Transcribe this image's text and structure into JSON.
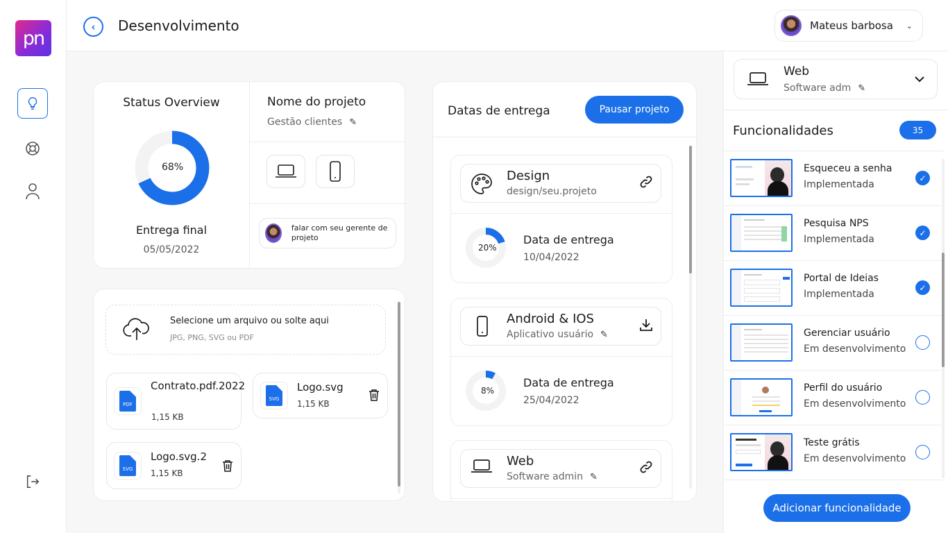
{
  "header": {
    "title": "Desenvolvimento",
    "user_name": "Mateus barbosa"
  },
  "sidebar": {
    "logo_text": "pn",
    "items": [
      "ideas",
      "support",
      "profile"
    ],
    "logout": "logout"
  },
  "status": {
    "title": "Status Overview",
    "progress": 68,
    "progress_label": "68%",
    "final_label": "Entrega final",
    "final_date": "05/05/2022"
  },
  "project": {
    "title": "Nome do projeto",
    "subtitle": "Gestão clientes",
    "manager_text": "falar com seu gerente de projeto"
  },
  "upload": {
    "title": "Selecione um arquivo ou solte aqui",
    "formats": "JPG, PNG, SVG ou PDF",
    "files": [
      {
        "name": "Contrato.pdf.2022",
        "size": "1,15 KB",
        "type": "PDF"
      },
      {
        "name": "Logo.svg",
        "size": "1,15 KB",
        "type": "SVG"
      },
      {
        "name": "Logo.svg.2",
        "size": "1,15 KB",
        "type": "SVG"
      }
    ]
  },
  "delivery": {
    "title": "Datas de entrega",
    "pause_label": "Pausar projeto",
    "items": [
      {
        "title": "Design",
        "subtitle": "design/seu.projeto",
        "date_label": "Data de entrega",
        "date": "10/04/2022",
        "progress": 20,
        "progress_label": "20%"
      },
      {
        "title": "Android & IOS",
        "subtitle": "Aplicativo usuário",
        "date_label": "Data de entrega",
        "date": "25/04/2022",
        "progress": 8,
        "progress_label": "8%"
      },
      {
        "title": "Web",
        "subtitle": "Software admin"
      }
    ]
  },
  "right": {
    "select_title": "Web",
    "select_sub": "Software adm",
    "func_title": "Funcionalidades",
    "count": "35",
    "features": [
      {
        "name": "Esqueceu a senha",
        "status": "Implementada",
        "done": true
      },
      {
        "name": "Pesquisa NPS",
        "status": "Implementada",
        "done": true
      },
      {
        "name": "Portal de Ideias",
        "status": "Implementada",
        "done": true
      },
      {
        "name": "Gerenciar usuário",
        "status": "Em desenvolvimento",
        "done": false
      },
      {
        "name": "Perfil do usuário",
        "status": "Em desenvolvimento",
        "done": false
      },
      {
        "name": "Teste grátis",
        "status": "Em desenvolvimento",
        "done": false
      }
    ],
    "add_label": "Adicionar funcionalidade"
  },
  "colors": {
    "accent": "#1b6fe8",
    "track": "#f3f3f3"
  }
}
